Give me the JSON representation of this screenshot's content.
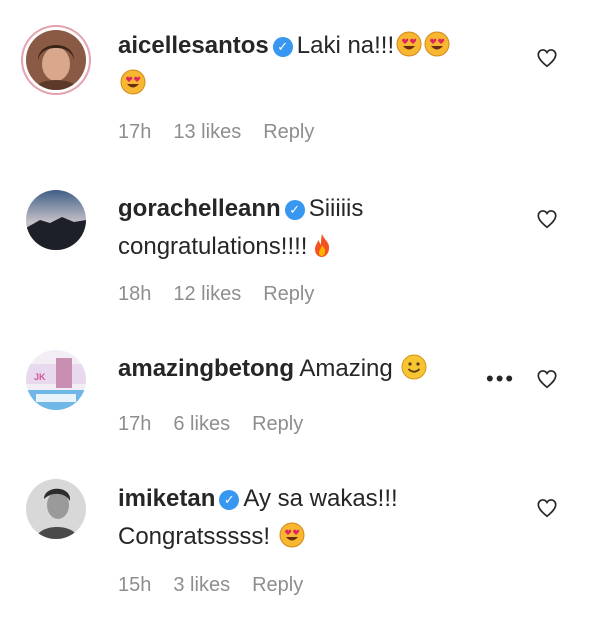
{
  "comments": [
    {
      "username": "aicellesantos",
      "verified": true,
      "text": "Laki na!!!",
      "time": "17h",
      "likes": "13 likes",
      "reply": "Reply"
    },
    {
      "username": "gorachelleann",
      "verified": true,
      "text": "Siiiiis congratulations!!!!",
      "time": "18h",
      "likes": "12 likes",
      "reply": "Reply"
    },
    {
      "username": "amazingbetong",
      "verified": false,
      "text": "Amazing",
      "time": "17h",
      "likes": "6 likes",
      "reply": "Reply",
      "more": "•••"
    },
    {
      "username": "imiketan",
      "verified": true,
      "text": "Ay sa wakas!!! Congratsssss!",
      "time": "15h",
      "likes": "3 likes",
      "reply": "Reply"
    }
  ],
  "icons": {
    "verified": "verified-badge-icon",
    "heart": "heart-outline-icon",
    "heart_eyes": "heart-eyes-emoji",
    "fire": "fire-emoji",
    "smile": "smile-emoji",
    "more": "more-options-icon"
  },
  "colors": {
    "verified": "#3897f0",
    "meta": "#8e8e8e",
    "text": "#262626"
  }
}
